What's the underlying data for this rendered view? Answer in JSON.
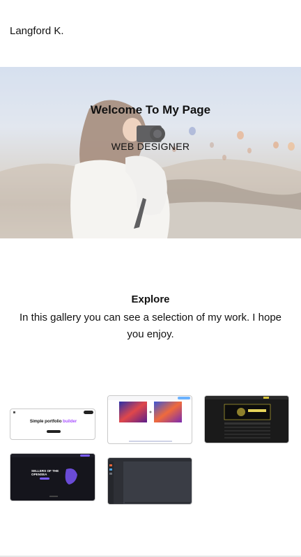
{
  "header": {
    "brand": "Langford K."
  },
  "hero": {
    "title": "Welcome To My Page",
    "subtitle": "WEB DESIGNER"
  },
  "explore": {
    "title": "Explore",
    "text": "In this gallery you can see a selection of my work. I hope you enjoy."
  },
  "gallery": {
    "items": [
      {
        "name": "Simple portfolio builder",
        "caption_main": "Simple portfolio ",
        "caption_accent": "builder"
      },
      {
        "name": "Image editor comparison"
      },
      {
        "name": "Dark marketplace site"
      },
      {
        "name": "Sellers of the OpenSea",
        "caption_line1": "SELLERS OF THE",
        "caption_line2": "OPENSEA"
      },
      {
        "name": "Dark dashboard app"
      }
    ]
  },
  "colors": {
    "accent_purple": "#a64dff",
    "dark_thumb": "#1c1c22",
    "dashboard_bg": "#3a3d45"
  }
}
